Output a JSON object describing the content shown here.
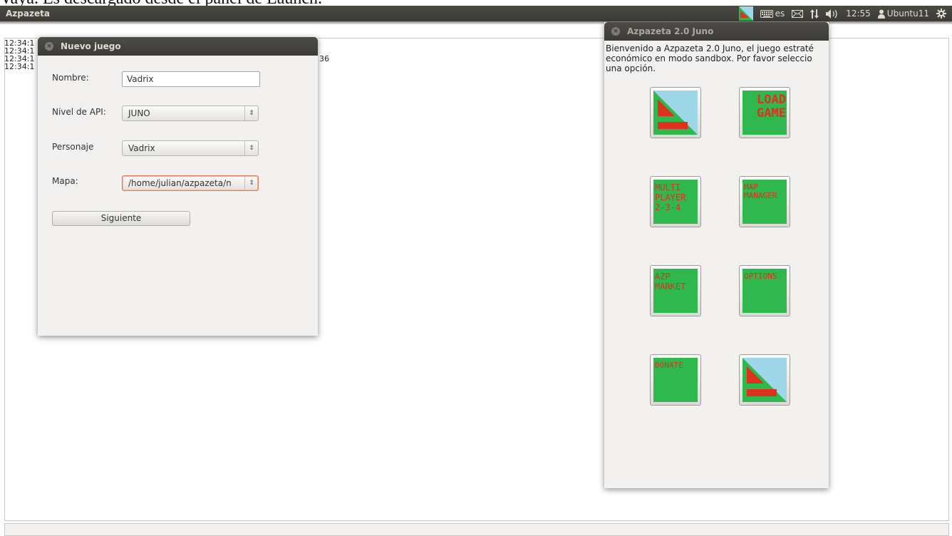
{
  "doc_caption": "Vaya. Es descargado desde el panel de Launch.",
  "panel": {
    "app_name": "Azpazeta",
    "keyboard_layout": "es",
    "clock": "12:55",
    "user": "Ubuntu11"
  },
  "log": {
    "lines": [
      "12:34:1",
      "12:34:1",
      "12:34:1",
      "12:34:1"
    ],
    "suffix": "36"
  },
  "new_game_dialog": {
    "title": "Nuevo juego",
    "name_label": "Nombre:",
    "name_value": "Vadrix",
    "api_label": "Nivel de API:",
    "api_value": "JUNO",
    "character_label": "Personaje",
    "character_value": "Vadrix",
    "map_label": "Mapa:",
    "map_value": "/home/julian/azpazeta/n",
    "next_button": "Siguiente"
  },
  "launcher": {
    "title": "Azpazeta 2.0 Juno",
    "welcome_text": "Bienvenido a Azpazeta 2.0 Juno, el juego estraté económico en modo sandbox. Por favor seleccio una opción.",
    "tiles": {
      "load_game": "LOAD\nGAME",
      "multiplayer": "MULTI\nPLAYER\n2-3-4",
      "map_manager": "MAP\nMANAGER",
      "azp_market": "AZP\nMARKET",
      "options": "OPTIONS",
      "donate": "DONATE"
    }
  },
  "colors": {
    "panel": "#3c3b37",
    "tile_green": "#2fb84e",
    "tile_text": "#e0301e",
    "logo_sky": "#9ed8e8",
    "focus": "#e0765a"
  }
}
